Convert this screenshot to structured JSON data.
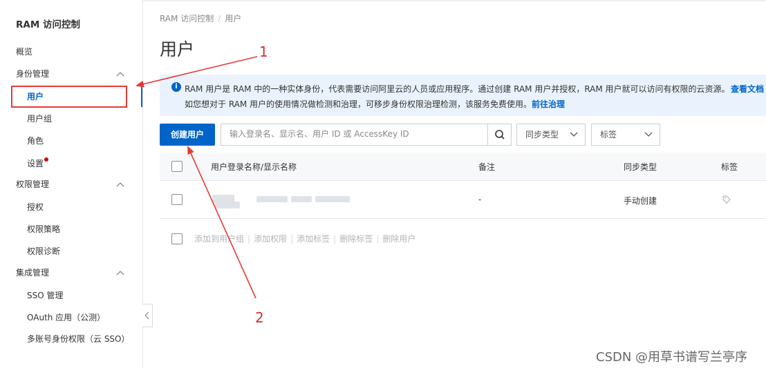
{
  "sidebar": {
    "title": "RAM 访问控制",
    "overview": "概览",
    "groups": [
      {
        "label": "身份管理",
        "items": [
          "用户",
          "用户组",
          "角色",
          "设置"
        ]
      },
      {
        "label": "权限管理",
        "items": [
          "授权",
          "权限策略",
          "权限诊断"
        ]
      },
      {
        "label": "集成管理",
        "items": [
          "SSO 管理",
          "OAuth 应用（公测）",
          "多账号身份权限（云 SSO）"
        ]
      }
    ],
    "active_item": "用户"
  },
  "breadcrumb": [
    "RAM 访问控制",
    "用户"
  ],
  "page_title": "用户",
  "info": {
    "line1": "RAM 用户是 RAM 中的一种实体身份，代表需要访问阿里云的人员或应用程序。通过创建 RAM 用户并授权，RAM 用户就可以访问有权限的云资源。",
    "doc_link": "查看文档",
    "line2": "如您想对于 RAM 用户的使用情况做检测和治理，可移步身份权限治理检测，该服务免费使用。",
    "govern_link": "前往治理"
  },
  "toolbar": {
    "create_label": "创建用户",
    "search_placeholder": "输入登录名、显示名、用户 ID 或 AccessKey ID",
    "sync_select": "同步类型",
    "tag_select": "标签"
  },
  "table": {
    "columns": [
      "用户登录名称/显示名称",
      "备注",
      "同步类型",
      "标签"
    ],
    "rows": [
      {
        "name": "",
        "note": "-",
        "sync": "手动创建",
        "tag": "tag-icon"
      }
    ]
  },
  "batch_actions": [
    "添加到用户组",
    "添加权限",
    "添加标签",
    "删除标签",
    "删除用户"
  ],
  "annotations": [
    "1",
    "2"
  ],
  "watermark": "CSDN @用草书谱写兰亭序",
  "colors": {
    "primary": "#0064c8",
    "annotation": "#e53935",
    "info_bg": "#eaf3fd",
    "dot": "#d40000"
  }
}
